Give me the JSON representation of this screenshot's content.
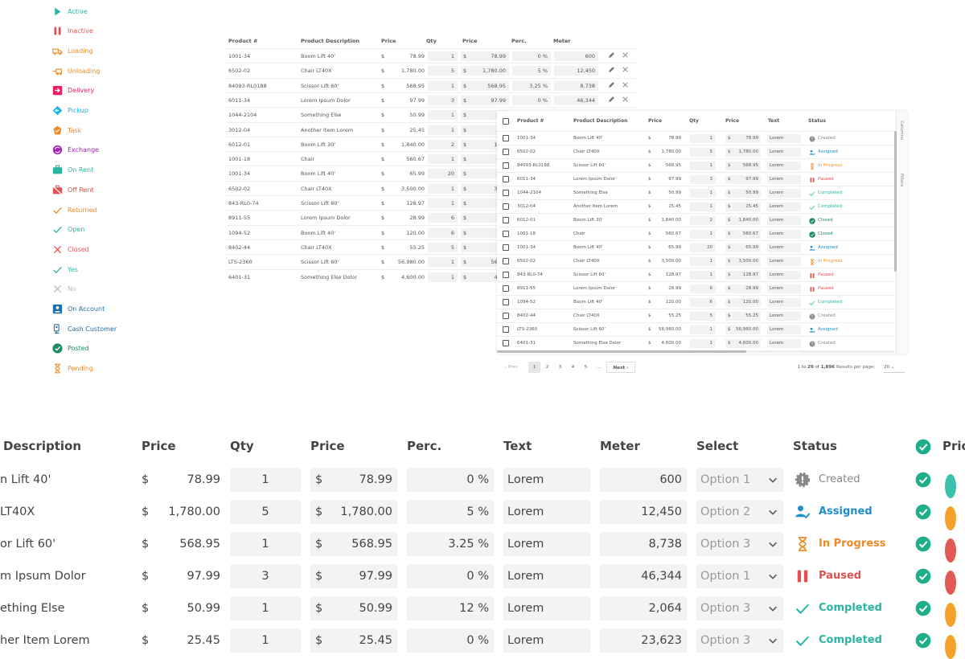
{
  "legend": [
    {
      "label": "Active",
      "icon": "play-icon",
      "color": "#2bb3a3"
    },
    {
      "label": "Inactive",
      "icon": "pause-icon",
      "color": "#e0524f"
    },
    {
      "label": "Loading",
      "icon": "truck-loading-icon",
      "color": "#f08a24"
    },
    {
      "label": "Unloading",
      "icon": "truck-unloading-icon",
      "color": "#f08a24"
    },
    {
      "label": "Delivery",
      "icon": "arrow-right-box-icon",
      "color": "#e91e63"
    },
    {
      "label": "Pickup",
      "icon": "diamond-arrow-icon",
      "color": "#13b5ea"
    },
    {
      "label": "Task",
      "icon": "task-icon",
      "color": "#f08a24"
    },
    {
      "label": "Exchange",
      "icon": "exchange-icon",
      "color": "#9c27b0"
    },
    {
      "label": "On Rent",
      "icon": "briefcase-icon",
      "color": "#2bb3a3"
    },
    {
      "label": "Off Rent",
      "icon": "briefcase-off-icon",
      "color": "#e0524f"
    },
    {
      "label": "Returned",
      "icon": "check-icon",
      "color": "#f08a24"
    },
    {
      "label": "Open",
      "icon": "check-icon",
      "color": "#2bb3a3"
    },
    {
      "label": "Closed",
      "icon": "x-icon",
      "color": "#e0524f"
    },
    {
      "label": "Yes",
      "icon": "check-icon",
      "color": "#2bb3a3"
    },
    {
      "label": "No",
      "icon": "x-icon",
      "color": "#bbbbbb"
    },
    {
      "label": "On Account",
      "icon": "account-icon",
      "color": "#1f6fa5"
    },
    {
      "label": "Cash Customer",
      "icon": "cash-icon",
      "color": "#1f6fa5"
    },
    {
      "label": "Posted",
      "icon": "check-circle-icon",
      "color": "#1f8a6a"
    },
    {
      "label": "Pending",
      "icon": "hourglass-icon",
      "color": "#f08a24"
    }
  ],
  "table1": {
    "headers": [
      "Product #",
      "Product Description",
      "Price",
      "Qty",
      "Price",
      "Perc.",
      "Meter"
    ],
    "rows": [
      {
        "num": "1001-34",
        "desc": "Boom Lift 40'",
        "cur": "$",
        "price": "78.99",
        "qty": "1",
        "cur2": "$",
        "price2": "78.99",
        "perc": "0 %",
        "meter": "600"
      },
      {
        "num": "6502-02",
        "desc": "Chair LT40X",
        "cur": "$",
        "price": "1,780.00",
        "qty": "5",
        "cur2": "$",
        "price2": "1,780.00",
        "perc": "5 %",
        "meter": "12,450"
      },
      {
        "num": "84093-RL0188",
        "desc": "Scissor Lift 60'",
        "cur": "$",
        "price": "568.95",
        "qty": "1",
        "cur2": "$",
        "price2": "568.95",
        "perc": "3.25 %",
        "meter": "8,738"
      },
      {
        "num": "6011-34",
        "desc": "Lorem Ipsum Dolor",
        "cur": "$",
        "price": "97.99",
        "qty": "3",
        "cur2": "$",
        "price2": "97.99",
        "perc": "0 %",
        "meter": "46,344"
      },
      {
        "num": "1044-2104",
        "desc": "Something Else",
        "cur": "$",
        "price": "50.99",
        "qty": "1",
        "cur2": "$",
        "price2": "5"
      },
      {
        "num": "3012-04",
        "desc": "Another Item Lorem",
        "cur": "$",
        "price": "25.45",
        "qty": "1",
        "cur2": "$",
        "price2": "2"
      },
      {
        "num": "6012-01",
        "desc": "Boom Lift 30'",
        "cur": "$",
        "price": "1,840.00",
        "qty": "2",
        "cur2": "$",
        "price2": "1,84"
      },
      {
        "num": "1001-18",
        "desc": "Chair",
        "cur": "$",
        "price": "560.67",
        "qty": "1",
        "cur2": "$",
        "price2": "56"
      },
      {
        "num": "1001-34",
        "desc": "Boom Lift 40'",
        "cur": "$",
        "price": "65.99",
        "qty": "20",
        "cur2": "$",
        "price2": "6"
      },
      {
        "num": "6502-02",
        "desc": "Chair LT40X",
        "cur": "$",
        "price": "3,500.00",
        "qty": "1",
        "cur2": "$",
        "price2": "3,50"
      },
      {
        "num": "843-RL0-74",
        "desc": "Scissor Lift 60'",
        "cur": "$",
        "price": "128.97",
        "qty": "1",
        "cur2": "$",
        "price2": "12"
      },
      {
        "num": "8911-55",
        "desc": "Lorem Ipsum Dolor",
        "cur": "$",
        "price": "28.99",
        "qty": "6",
        "cur2": "$",
        "price2": "2"
      },
      {
        "num": "1094-52",
        "desc": "Boom Lift 40'",
        "cur": "$",
        "price": "120.00",
        "qty": "6",
        "cur2": "$",
        "price2": "12"
      },
      {
        "num": "8402-44",
        "desc": "Chair LT40X",
        "cur": "$",
        "price": "55.25",
        "qty": "5",
        "cur2": "$",
        "price2": "5"
      },
      {
        "num": "LTS-2360",
        "desc": "Scissor Lift 60'",
        "cur": "$",
        "price": "56,980.00",
        "qty": "1",
        "cur2": "$",
        "price2": "56,98"
      },
      {
        "num": "6401-31",
        "desc": "Something Else Dolor",
        "cur": "$",
        "price": "4,600.00",
        "qty": "1",
        "cur2": "$",
        "price2": "4,60"
      }
    ]
  },
  "table2": {
    "headers": [
      "Product #",
      "Product Description",
      "Price",
      "Qty",
      "Price",
      "Text",
      "Status"
    ],
    "side_columns": "Columns",
    "side_filters": "Filters",
    "rows": [
      {
        "num": "1001-34",
        "desc": "Boom Lift 40'",
        "cur": "$",
        "price": "78.99",
        "qty": "1",
        "cur2": "$",
        "price2": "78.99",
        "text": "Lorem",
        "status": "Created",
        "status_icon": "gear-icon"
      },
      {
        "num": "6502-02",
        "desc": "Chair LT40X",
        "cur": "$",
        "price": "1,780.00",
        "qty": "5",
        "cur2": "$",
        "price2": "1,780.00",
        "text": "Lorem",
        "status": "Assigned",
        "status_icon": "user-check-icon"
      },
      {
        "num": "84093-RL0188",
        "desc": "Scissor Lift 60'",
        "cur": "$",
        "price": "568.95",
        "qty": "1",
        "cur2": "$",
        "price2": "568.95",
        "text": "Lorem",
        "status": "In Progress",
        "status_icon": "hourglass-icon"
      },
      {
        "num": "6011-34",
        "desc": "Lorem Ipsum Dolor",
        "cur": "$",
        "price": "97.99",
        "qty": "3",
        "cur2": "$",
        "price2": "97.99",
        "text": "Lorem",
        "status": "Paused",
        "status_icon": "pause-icon"
      },
      {
        "num": "1044-2104",
        "desc": "Something Else",
        "cur": "$",
        "price": "50.99",
        "qty": "1",
        "cur2": "$",
        "price2": "50.99",
        "text": "Lorem",
        "status": "Completed",
        "status_icon": "check-icon"
      },
      {
        "num": "3012-04",
        "desc": "Another Item Lorem",
        "cur": "$",
        "price": "25.45",
        "qty": "1",
        "cur2": "$",
        "price2": "25.45",
        "text": "Lorem",
        "status": "Completed",
        "status_icon": "check-icon"
      },
      {
        "num": "6012-01",
        "desc": "Boom Lift 30'",
        "cur": "$",
        "price": "1,840.00",
        "qty": "2",
        "cur2": "$",
        "price2": "1,840.00",
        "text": "Lorem",
        "status": "Closed",
        "status_icon": "check-circle-icon"
      },
      {
        "num": "1001-18",
        "desc": "Chair",
        "cur": "$",
        "price": "560.67",
        "qty": "1",
        "cur2": "$",
        "price2": "560.67",
        "text": "Lorem",
        "status": "Closed",
        "status_icon": "check-circle-icon"
      },
      {
        "num": "1001-34",
        "desc": "Boom Lift 40'",
        "cur": "$",
        "price": "65.99",
        "qty": "20",
        "cur2": "$",
        "price2": "65.99",
        "text": "Lorem",
        "status": "Assigned",
        "status_icon": "user-check-icon"
      },
      {
        "num": "6502-02",
        "desc": "Chair LT40X",
        "cur": "$",
        "price": "3,500.00",
        "qty": "1",
        "cur2": "$",
        "price2": "3,500.00",
        "text": "Lorem",
        "status": "In Progress",
        "status_icon": "hourglass-icon"
      },
      {
        "num": "843-RL0-74",
        "desc": "Scissor Lift 60'",
        "cur": "$",
        "price": "128.97",
        "qty": "1",
        "cur2": "$",
        "price2": "128.97",
        "text": "Lorem",
        "status": "Paused",
        "status_icon": "pause-icon"
      },
      {
        "num": "8911-55",
        "desc": "Lorem Ipsum Dolor",
        "cur": "$",
        "price": "28.99",
        "qty": "6",
        "cur2": "$",
        "price2": "28.99",
        "text": "Lorem",
        "status": "Paused",
        "status_icon": "pause-icon"
      },
      {
        "num": "1094-52",
        "desc": "Boom Lift 40'",
        "cur": "$",
        "price": "120.00",
        "qty": "6",
        "cur2": "$",
        "price2": "120.00",
        "text": "Lorem",
        "status": "Completed",
        "status_icon": "check-icon"
      },
      {
        "num": "8402-44",
        "desc": "Chair LT40X",
        "cur": "$",
        "price": "55.25",
        "qty": "5",
        "cur2": "$",
        "price2": "55.25",
        "text": "Lorem",
        "status": "Created",
        "status_icon": "gear-icon"
      },
      {
        "num": "LTS-2360",
        "desc": "Scissor Lift 60'",
        "cur": "$",
        "price": "56,980.00",
        "qty": "1",
        "cur2": "$",
        "price2": "56,980.00",
        "text": "Lorem",
        "status": "Assigned",
        "status_icon": "user-check-icon"
      },
      {
        "num": "6401-31",
        "desc": "Something Else Dolor",
        "cur": "$",
        "price": "4,600.00",
        "qty": "1",
        "cur2": "$",
        "price2": "4,600.00",
        "text": "Lorem",
        "status": "Created",
        "status_icon": "gear-icon"
      }
    ]
  },
  "pager": {
    "prev": "Prev",
    "pages": [
      "1",
      "2",
      "3",
      "4",
      "5",
      "..."
    ],
    "next": "Next",
    "range_a": "1 to ",
    "range_b": "20",
    "range_c": " of ",
    "range_d": "1,896",
    "per_page_label": "Results per page:",
    "per_page_value": "20"
  },
  "big": {
    "headers": [
      "Description",
      "Price",
      "Qty",
      "Price",
      "Perc.",
      "Text",
      "Meter",
      "Select",
      "Status",
      "Prio"
    ],
    "rows": [
      {
        "desc": "n Lift 40'",
        "cur": "$",
        "price": "78.99",
        "qty": "1",
        "cur2": "$",
        "price2": "78.99",
        "perc": "0 %",
        "text": "Lorem",
        "meter": "600",
        "select": "Option 1",
        "status": "Created",
        "status_icon": "gear-icon",
        "prio_color": "#3cc1ad"
      },
      {
        "desc": " LT40X",
        "cur": "$",
        "price": "1,780.00",
        "qty": "5",
        "cur2": "$",
        "price2": "1,780.00",
        "perc": "5 %",
        "text": "Lorem",
        "meter": "12,450",
        "select": "Option 2",
        "status": "Assigned",
        "status_icon": "user-check-icon",
        "prio_color": "#f3a12c"
      },
      {
        "desc": "or Lift 60'",
        "cur": "$",
        "price": "568.95",
        "qty": "1",
        "cur2": "$",
        "price2": "568.95",
        "perc": "3.25 %",
        "text": "Lorem",
        "meter": "8,738",
        "select": "Option 3",
        "status": "In Progress",
        "status_icon": "hourglass-icon",
        "prio_color": "#e25a56"
      },
      {
        "desc": "m Ipsum Dolor",
        "cur": "$",
        "price": "97.99",
        "qty": "3",
        "cur2": "$",
        "price2": "97.99",
        "perc": "0 %",
        "text": "Lorem",
        "meter": "46,344",
        "select": "Option 1",
        "status": "Paused",
        "status_icon": "pause-icon",
        "prio_color": "#e25a56"
      },
      {
        "desc": "ething Else",
        "cur": "$",
        "price": "50.99",
        "qty": "1",
        "cur2": "$",
        "price2": "50.99",
        "perc": "12 %",
        "text": "Lorem",
        "meter": "2,064",
        "select": "Option 3",
        "status": "Completed",
        "status_icon": "check-icon",
        "prio_color": "#f3a12c"
      },
      {
        "desc": "her Item Lorem",
        "cur": "$",
        "price": "25.45",
        "qty": "1",
        "cur2": "$",
        "price2": "25.45",
        "perc": "0 %",
        "text": "Lorem",
        "meter": "23,623",
        "select": "Option 3",
        "status": "Completed",
        "status_icon": "check-icon",
        "prio_color": "#f3a12c"
      }
    ]
  },
  "colors": {
    "created": "#888888",
    "assigned": "#1f8ec9",
    "in_progress": "#f08a24",
    "paused": "#e0524f",
    "completed": "#2bb3a3",
    "closed": "#1f8a6a",
    "check_green": "#1fae8a"
  }
}
